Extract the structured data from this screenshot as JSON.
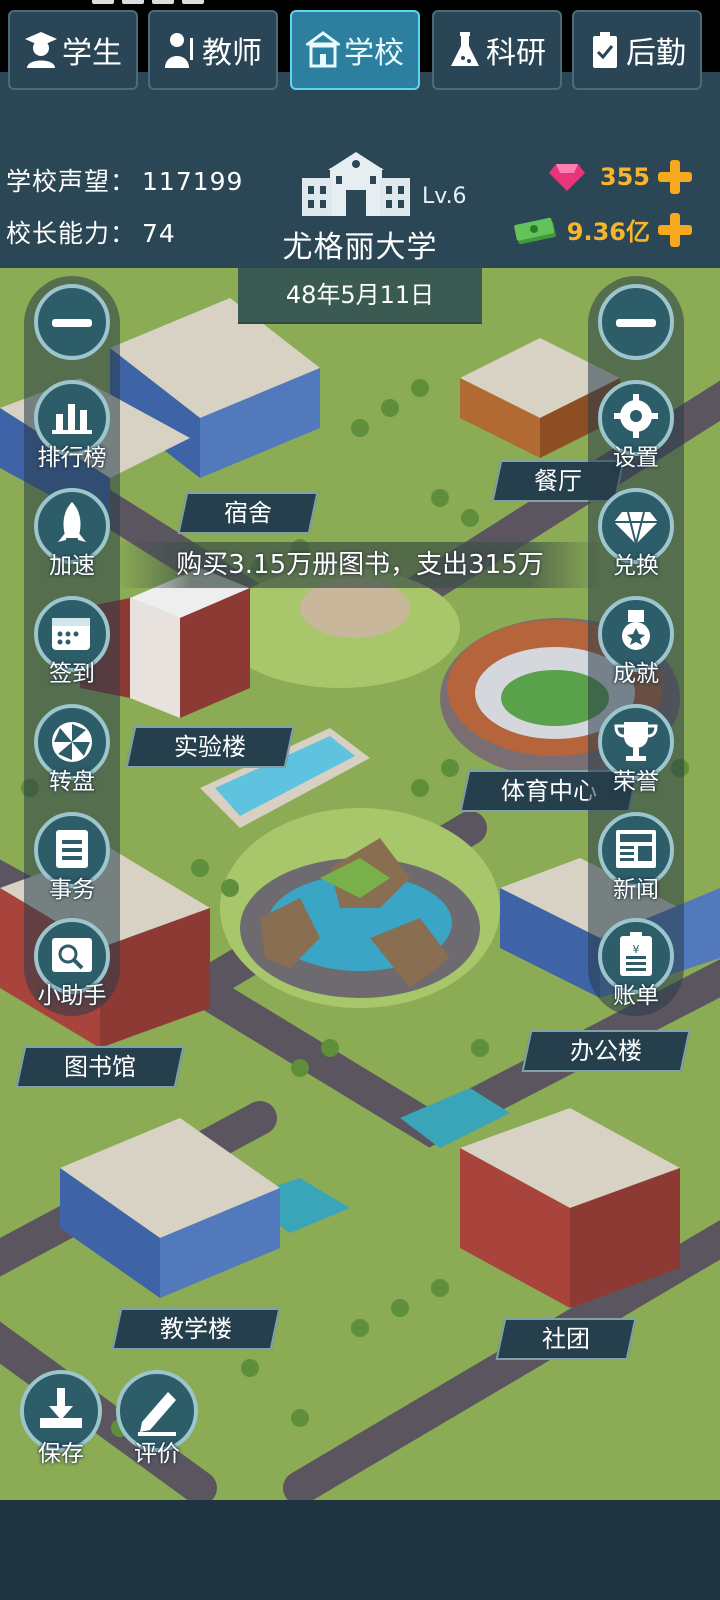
{
  "header": {
    "reputation_label": "学校声望：",
    "reputation_value": "117199",
    "ability_label": "校长能力：",
    "ability_value": "74",
    "school_name": "尤格丽大学",
    "level": "Lv.6",
    "gems": "355",
    "money": "9.36亿",
    "date": "48年5月11日"
  },
  "left_menu": {
    "items": [
      {
        "label": "排行榜",
        "icon": "chart-icon"
      },
      {
        "label": "加速",
        "icon": "rocket-icon"
      },
      {
        "label": "签到",
        "icon": "calendar-icon"
      },
      {
        "label": "转盘",
        "icon": "wheel-icon"
      },
      {
        "label": "事务",
        "icon": "clipboard-icon"
      },
      {
        "label": "小助手",
        "icon": "assistant-icon"
      }
    ]
  },
  "right_menu": {
    "items": [
      {
        "label": "设置",
        "icon": "gear-icon"
      },
      {
        "label": "兑换",
        "icon": "diamond-icon"
      },
      {
        "label": "成就",
        "icon": "medal-icon"
      },
      {
        "label": "荣誉",
        "icon": "trophy-icon"
      },
      {
        "label": "新闻",
        "icon": "newspaper-icon"
      },
      {
        "label": "账单",
        "icon": "bill-icon"
      }
    ]
  },
  "buildings": {
    "dorm": "宿舍",
    "canteen": "餐厅",
    "lab": "实验楼",
    "sports": "体育中心",
    "library": "图书馆",
    "office": "办公楼",
    "teaching": "教学楼",
    "club": "社团"
  },
  "toast": "购买3.15万册图书，支出315万",
  "bottom_buttons": {
    "save": "保存",
    "rate": "评价"
  },
  "tabs": [
    {
      "label": "学生",
      "icon": "student-icon"
    },
    {
      "label": "教师",
      "icon": "teacher-icon"
    },
    {
      "label": "学校",
      "icon": "school-icon"
    },
    {
      "label": "科研",
      "icon": "flask-icon"
    },
    {
      "label": "后勤",
      "icon": "logistics-icon"
    }
  ],
  "active_tab": "学校"
}
